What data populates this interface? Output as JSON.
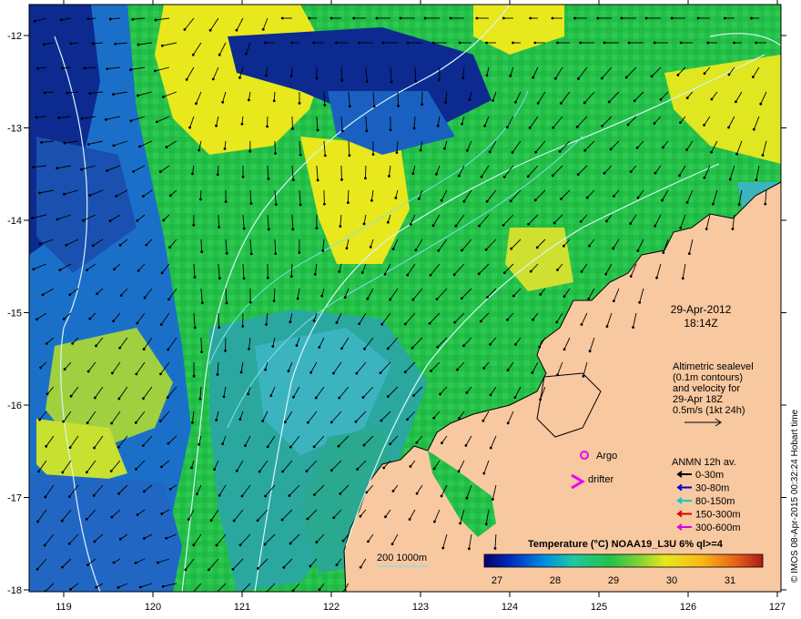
{
  "map": {
    "lon_ticks": [
      "119",
      "120",
      "121",
      "122",
      "123",
      "124",
      "125",
      "126",
      "127"
    ],
    "lat_ticks": [
      "-12",
      "-13",
      "-14",
      "-15",
      "-16",
      "-17",
      "-18"
    ],
    "date": "29-Apr-2012",
    "time": "18:14Z",
    "altimetry_lines": [
      "Altimetric sealevel",
      "(0.1m contours)",
      "and velocity for",
      "29-Apr 18Z",
      "0.5m/s (1kt 24h)"
    ],
    "argo_label": "Argo",
    "drifter_label": "drifter",
    "anmn": {
      "title": "ANMN 12h av.",
      "items": [
        {
          "label": "0-30m",
          "color": "#000000"
        },
        {
          "label": "30-80m",
          "color": "#0000cc"
        },
        {
          "label": "80-150m",
          "color": "#00cccc"
        },
        {
          "label": "150-300m",
          "color": "#dd0000"
        },
        {
          "label": "300-600m",
          "color": "#dd00dd"
        }
      ]
    },
    "colorbar": {
      "title": "Temperature (°C) NOAA19_L3U 6% ql>=4",
      "ticks": [
        "27",
        "28",
        "29",
        "30",
        "31"
      ],
      "colors": [
        "#00006e",
        "#0030c0",
        "#0090e0",
        "#20c8a0",
        "#22c24a",
        "#7ad038",
        "#e8e81c",
        "#f8b818",
        "#e86418",
        "#b01818"
      ]
    },
    "bathy_label": "200  1000m",
    "credit": "© IMOS 08-Apr-2015 00:32:24 Hobart time",
    "colors": {
      "land": "#f8c8a0",
      "cold": "#1560c0",
      "deep_cold": "#0a1e8c",
      "mid": "#22c24a",
      "warm": "#e8e81c",
      "contour": "#d8f4f8",
      "isobath": "#80e0f0"
    }
  }
}
